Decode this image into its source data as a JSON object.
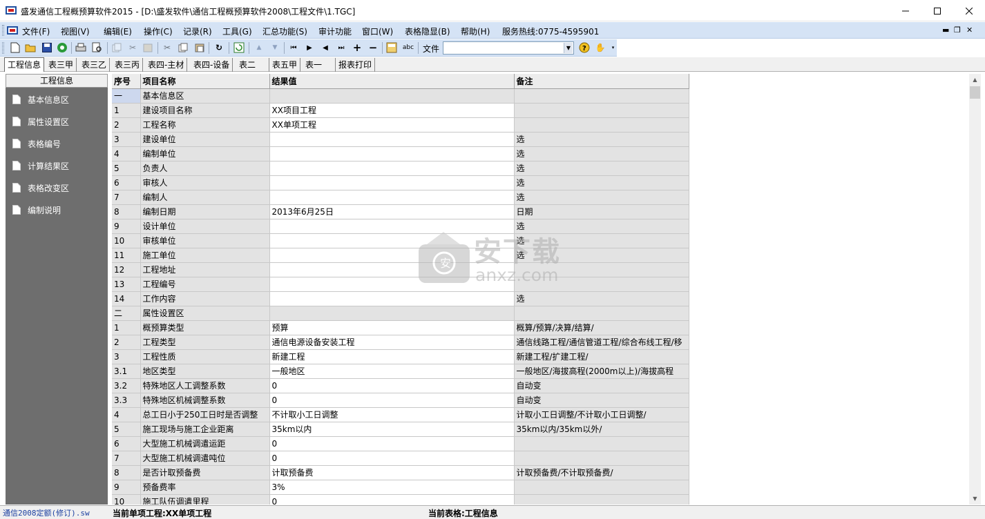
{
  "window": {
    "title": "盛发通信工程概预算软件2015 - [D:\\盛发软件\\通信工程概预算软件2008\\工程文件\\1.TGC]"
  },
  "menu": [
    "文件(F)",
    "视图(V)",
    "编辑(E)",
    "操作(C)",
    "记录(R)",
    "工具(G)",
    "汇总功能(S)",
    "审计功能",
    "窗口(W)",
    "表格隐显(B)",
    "帮助(H)",
    "服务热线:0775-4595901"
  ],
  "toolbar": {
    "file_label": "文件",
    "file_value": ""
  },
  "tabs": [
    "工程信息",
    "表三甲",
    "表三乙",
    "表三丙",
    "表四-主材",
    "表四-设备",
    "表二",
    "表五甲",
    "表一",
    "报表打印"
  ],
  "sidebar": {
    "header": "工程信息",
    "items": [
      "基本信息区",
      "属性设置区",
      "表格编号",
      "计算结果区",
      "表格改变区",
      "编制说明"
    ]
  },
  "grid": {
    "columns": [
      "序号",
      "项目名称",
      "结果值",
      "备注"
    ],
    "rows": [
      [
        "一",
        "基本信息区",
        "",
        ""
      ],
      [
        "1",
        "建设项目名称",
        "XX项目工程",
        ""
      ],
      [
        "2",
        "工程名称",
        "XX单项工程",
        ""
      ],
      [
        "3",
        "建设单位",
        "",
        "选"
      ],
      [
        "4",
        "编制单位",
        "",
        "选"
      ],
      [
        "5",
        "负责人",
        "",
        "选"
      ],
      [
        "6",
        "审核人",
        "",
        "选"
      ],
      [
        "7",
        "编制人",
        "",
        "选"
      ],
      [
        "8",
        "编制日期",
        "2013年6月25日",
        "日期"
      ],
      [
        "9",
        "设计单位",
        "",
        "选"
      ],
      [
        "10",
        "审核单位",
        "",
        "选"
      ],
      [
        "11",
        "施工单位",
        "",
        "选"
      ],
      [
        "12",
        "工程地址",
        "",
        ""
      ],
      [
        "13",
        "工程编号",
        "",
        ""
      ],
      [
        "14",
        "工作内容",
        "",
        "选"
      ],
      [
        "二",
        "属性设置区",
        "",
        ""
      ],
      [
        "1",
        "概预算类型",
        "预算",
        "概算/预算/决算/结算/"
      ],
      [
        "2",
        "工程类型",
        "通信电源设备安装工程",
        "通信线路工程/通信管道工程/综合布线工程/移"
      ],
      [
        "3",
        "工程性质",
        "新建工程",
        "新建工程/扩建工程/"
      ],
      [
        "3.1",
        "地区类型",
        "一般地区",
        "一般地区/海拔高程(2000m以上)/海拔高程"
      ],
      [
        "3.2",
        "特殊地区人工调整系数",
        "0",
        "自动变"
      ],
      [
        "3.3",
        "特殊地区机械调整系数",
        "0",
        "自动变"
      ],
      [
        "4",
        "总工日小于250工日时是否调整",
        "不计取小工日调整",
        "计取小工日调整/不计取小工日调整/"
      ],
      [
        "5",
        "施工现场与施工企业距离",
        "35km以内",
        "35km以内/35km以外/"
      ],
      [
        "6",
        "大型施工机械调遣运距",
        "0",
        ""
      ],
      [
        "7",
        "大型施工机械调遣吨位",
        "0",
        ""
      ],
      [
        "8",
        "是否计取预备费",
        "计取预备费",
        "计取预备费/不计取预备费/"
      ],
      [
        "9",
        "预备费率",
        "3%",
        ""
      ],
      [
        "10",
        "施工队伍调遣里程",
        "0",
        ""
      ]
    ]
  },
  "watermark": {
    "name": "安下载",
    "url": "anxz.com"
  },
  "status": {
    "left": "通信2008定额(修订).sw",
    "middle": "当前单项工程:XX单项工程",
    "right": "当前表格:工程信息"
  }
}
